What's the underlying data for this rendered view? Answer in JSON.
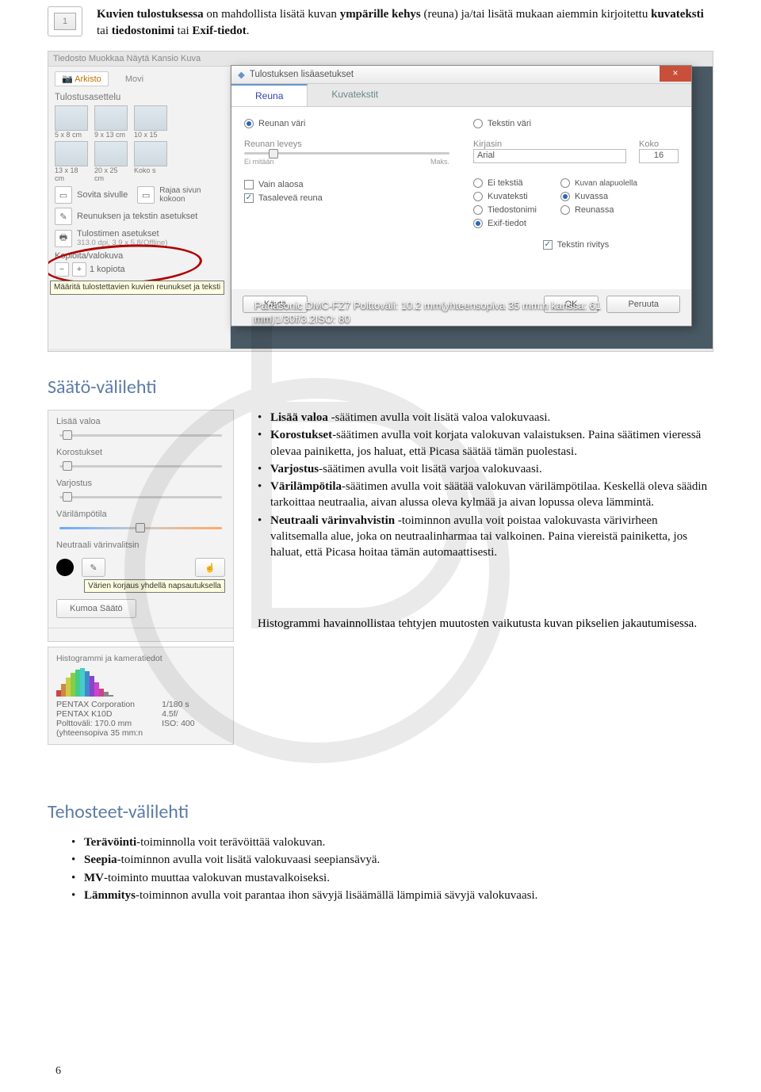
{
  "intro": {
    "step_number": "1",
    "text_prefix": "Kuvien tulostuksessa",
    "text_mid1": " on mahdollista lisätä kuvan ",
    "b2": "ympärille kehys",
    "text_mid2": " (reuna) ja/tai lisätä mukaan aiemmin kirjoitettu ",
    "b3": "kuvateksti",
    "text_mid3": " tai ",
    "b4": "tiedostonimi",
    "text_mid4": " tai ",
    "b5": "Exif-tiedot",
    "text_end": "."
  },
  "scr": {
    "menubar": "Tiedosto   Muokkaa   Näytä   Kansio   Kuva",
    "arkisto": "Arkisto",
    "movies": "Movi",
    "section": "Tulostusasettelu",
    "thumb_labels": [
      "5 x 8 cm",
      "9 x 13 cm",
      "10 x 15",
      "13 x 18 cm",
      "20 x 25 cm",
      "Koko s"
    ],
    "sovita": "Sovita sivulle",
    "rajaa": "Rajaa sivun\nkokoon",
    "reun_asetukset": "Reunuksen ja tekstin asetukset",
    "tooltip": "Määritä tulostettavien kuvien reunukset ja teksti",
    "tulostimen": "Tulostimen asetukset",
    "dpi": "313.0 dpi, 3.9 x 5.8(Offline)",
    "kopioita": "Kopioita/valokuva",
    "kopiota_val": "1 kopiota",
    "dialog_title": "Tulostuksen lisäasetukset",
    "tab1": "Reuna",
    "tab2": "Kuvatekstit",
    "reunan_vari": "Reunan väri",
    "tekstin_vari": "Tekstin väri",
    "reunan_leveys": "Reunan leveys",
    "kirjasin": "Kirjasin",
    "koko": "Koko",
    "arial": "Arial",
    "koko_val": "16",
    "ei_mitaan": "Ei mitään",
    "maks": "Maks.",
    "vain_alaosa": "Vain alaosa",
    "tasaleveä": "Tasaleveä reuna",
    "ei_tekstia": "Ei tekstiä",
    "kuvateksti": "Kuvateksti",
    "tiedostonimi": "Tiedostonimi",
    "exif": "Exif-tiedot",
    "kuvan_alap": "Kuvan alapuolella",
    "kuvassa": "Kuvassa",
    "reunassa": "Reunassa",
    "tekstin_rivitys": "Tekstin rivitys",
    "kayta": "Käytä",
    "ok": "OK",
    "peruuta": "Peruuta",
    "photo_caption": "Panasonic DMC-FZ7 Polttoväli: 10.2 mm(yhteensopiva 35 mm:n kanssa: 61 mm)1/30f/3.2ISO: 80"
  },
  "heading_saato": "Säätö-välilehti",
  "panel": {
    "lisaa_valoa": "Lisää valoa",
    "korostukset": "Korostukset",
    "varjostus": "Varjostus",
    "varilampotila": "Värilämpötila",
    "neutraali": "Neutraali värinvalitsin",
    "tip": "Värien korjaus yhdellä napsautuksella",
    "kumoa": "Kumoa Säätö"
  },
  "bullets_saato": {
    "b1_b": "Lisää valoa",
    "b1_t": " -säätimen avulla voit lisätä valoa valokuvaasi.",
    "b2_b": "Korostukset",
    "b2_t": "-säätimen avulla voit korjata valokuvan valaistuksen. Paina säätimen vieressä olevaa painiketta, jos haluat, että Picasa säätää tämän puolestasi.",
    "b3_b": "Varjostus",
    "b3_t": "-säätimen avulla voit lisätä varjoa valokuvaasi.",
    "b4_b": "Värilämpötila",
    "b4_t": "-säätimen avulla voit säätää valokuvan värilämpötilaa. Keskellä oleva säädin tarkoittaa neutraalia, aivan alussa oleva kylmää ja aivan lopussa oleva lämmintä.",
    "b5_b": "Neutraali värinvahvistin",
    "b5_t": " -toiminnon avulla voit poistaa valokuvasta värivirheen valitsemalla alue, joka on neutraalinharmaa tai valkoinen. Paina viereistä painiketta, jos haluat, että Picasa hoitaa tämän automaattisesti."
  },
  "hist": {
    "title": "Histogrammi ja kameratiedot",
    "cam1": "PENTAX Corporation",
    "cam2": "PENTAX K10D",
    "cam3": "Polttoväli: 170.0 mm",
    "cam4": "(yhteensopiva 35 mm:n",
    "col2_1": "1/180 s",
    "col2_2": "4.5f/",
    "col2_3": "ISO: 400",
    "desc": "Histogrammi havainnollistaa tehtyjen muutosten vaikutusta kuvan pikselien jakautumisessa."
  },
  "heading_tehosteet": "Tehosteet-välilehti",
  "bullets_teh": {
    "b1_b": "Terävöinti",
    "b1_t": "-toiminnolla voit terävöittää valokuvan.",
    "b2_b": "Seepia",
    "b2_t": "-toiminnon avulla voit lisätä valokuvaasi seepiansävyä.",
    "b3_b": "MV",
    "b3_t": "-toiminto muuttaa valokuvan mustavalkoiseksi.",
    "b4_b": "Lämmitys",
    "b4_t": "-toiminnon avulla voit parantaa ihon sävyjä lisäämällä lämpimiä sävyjä valokuvaasi."
  },
  "page_number": "6"
}
